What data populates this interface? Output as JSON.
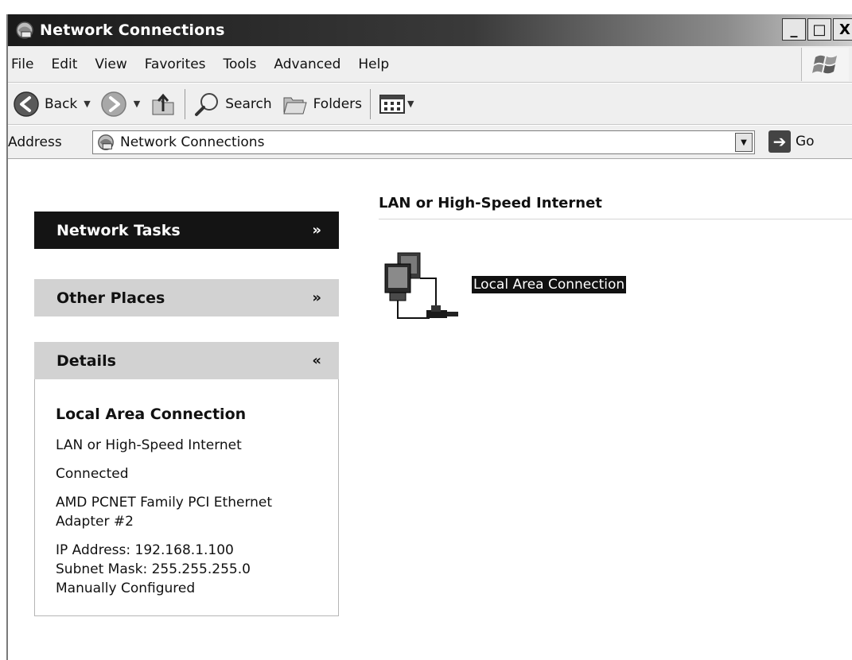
{
  "window": {
    "title": "Network Connections",
    "minimize": "_",
    "maximize": "□",
    "close": "X"
  },
  "menu": {
    "items": [
      "File",
      "Edit",
      "View",
      "Favorites",
      "Tools",
      "Advanced",
      "Help"
    ]
  },
  "toolbar": {
    "back_label": "Back",
    "search_label": "Search",
    "folders_label": "Folders"
  },
  "address": {
    "label": "Address",
    "value": "Network Connections",
    "go_label": "Go"
  },
  "taskpane": {
    "network_tasks": "Network Tasks",
    "other_places": "Other Places",
    "details": "Details",
    "details_body": {
      "title": "Local Area Connection",
      "type": "LAN or High-Speed Internet",
      "status": "Connected",
      "adapter": "AMD PCNET Family PCI Ethernet Adapter #2",
      "ip": "IP Address: 192.168.1.100",
      "subnet": "Subnet Mask: 255.255.255.0",
      "config": "Manually Configured"
    }
  },
  "content": {
    "group_header": "LAN or High-Speed Internet",
    "connection_label": "Local Area Connection"
  }
}
